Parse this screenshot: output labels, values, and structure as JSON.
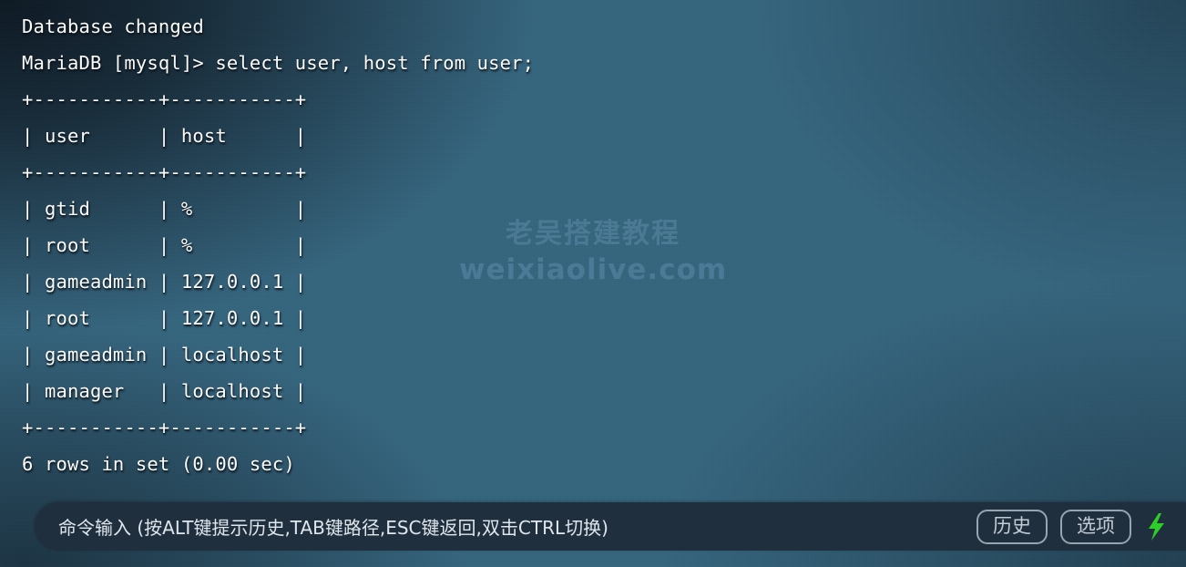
{
  "theme": {
    "background_color": "#35657e",
    "terminal_text_color": "#fdfdfd",
    "command_bar_color": "#1f2f3e",
    "button_border_color": "#97a5b0",
    "bolt_color": "#2ecc28",
    "watermark_color": "#6ea0c3"
  },
  "terminal": {
    "lines": [
      "Database changed",
      "MariaDB [mysql]> select user, host from user;",
      "+-----------+-----------+",
      "| user      | host      |",
      "+-----------+-----------+",
      "| gtid      | %         |",
      "| root      | %         |",
      "| gameadmin | 127.0.0.1 |",
      "| root      | 127.0.0.1 |",
      "| gameadmin | localhost |",
      "| manager   | localhost |",
      "+-----------+-----------+",
      "6 rows in set (0.00 sec)"
    ],
    "status_message": "Database changed",
    "prompt": "MariaDB [mysql]>",
    "query": "select user, host from user;",
    "result_summary": "6 rows in set (0.00 sec)",
    "table": {
      "columns": [
        "user",
        "host"
      ],
      "rows": [
        [
          "gtid",
          "%"
        ],
        [
          "root",
          "%"
        ],
        [
          "gameadmin",
          "127.0.0.1"
        ],
        [
          "root",
          "127.0.0.1"
        ],
        [
          "gameadmin",
          "localhost"
        ],
        [
          "manager",
          "localhost"
        ]
      ],
      "row_count": 6
    }
  },
  "watermark": {
    "line1": "老吴搭建教程",
    "line2": "weixiaolive.com"
  },
  "command_bar": {
    "hint": "命令输入 (按ALT键提示历史,TAB键路径,ESC键返回,双击CTRL切换)",
    "history_button": "历史",
    "options_button": "选项",
    "bolt_icon": "lightning-bolt-icon"
  }
}
